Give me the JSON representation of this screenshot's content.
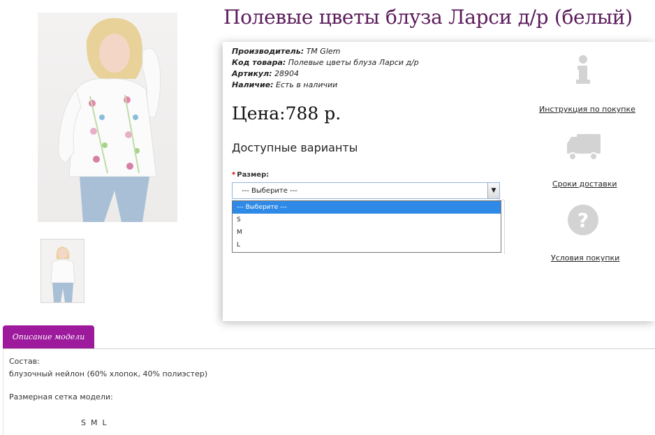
{
  "product": {
    "title": "Полевые цветы блуза Ларси д/р (белый)",
    "meta": [
      {
        "label": "Производитель:",
        "value": " ТМ Glem"
      },
      {
        "label": "Код товара:",
        "value": " Полевые цветы блуза Ларси д/р"
      },
      {
        "label": "Артикул:",
        "value": " 28904"
      },
      {
        "label": "Наличие:",
        "value": " Есть в наличии"
      }
    ],
    "price": "Цена:788 р.",
    "variants_title": "Доступные варианты",
    "size_label": "Размер:",
    "size_required_mark": "*",
    "size_select": {
      "selected": "--- Выберите ---",
      "options": [
        "--- Выберите ---",
        "S",
        "M",
        "L"
      ]
    }
  },
  "side_links": [
    {
      "icon": "info-icon",
      "label": "Инструкция по покупке"
    },
    {
      "icon": "truck-icon",
      "label": "Сроки доставки"
    },
    {
      "icon": "question-icon",
      "label": "Условия покупки"
    }
  ],
  "tabs": [
    {
      "label": "Описание модели"
    }
  ],
  "description": {
    "composition_label": "Состав:",
    "composition_value": "блузочный нейлон (60% хлопок, 40% полиэстер)",
    "sizes_label": "Размерная сетка модели:",
    "sizes_value": "S  M  L"
  },
  "colors": {
    "title": "#5a1a5a",
    "tab": "#9d1a9d",
    "selected_option": "#2e8ae6",
    "required": "#d00000"
  }
}
